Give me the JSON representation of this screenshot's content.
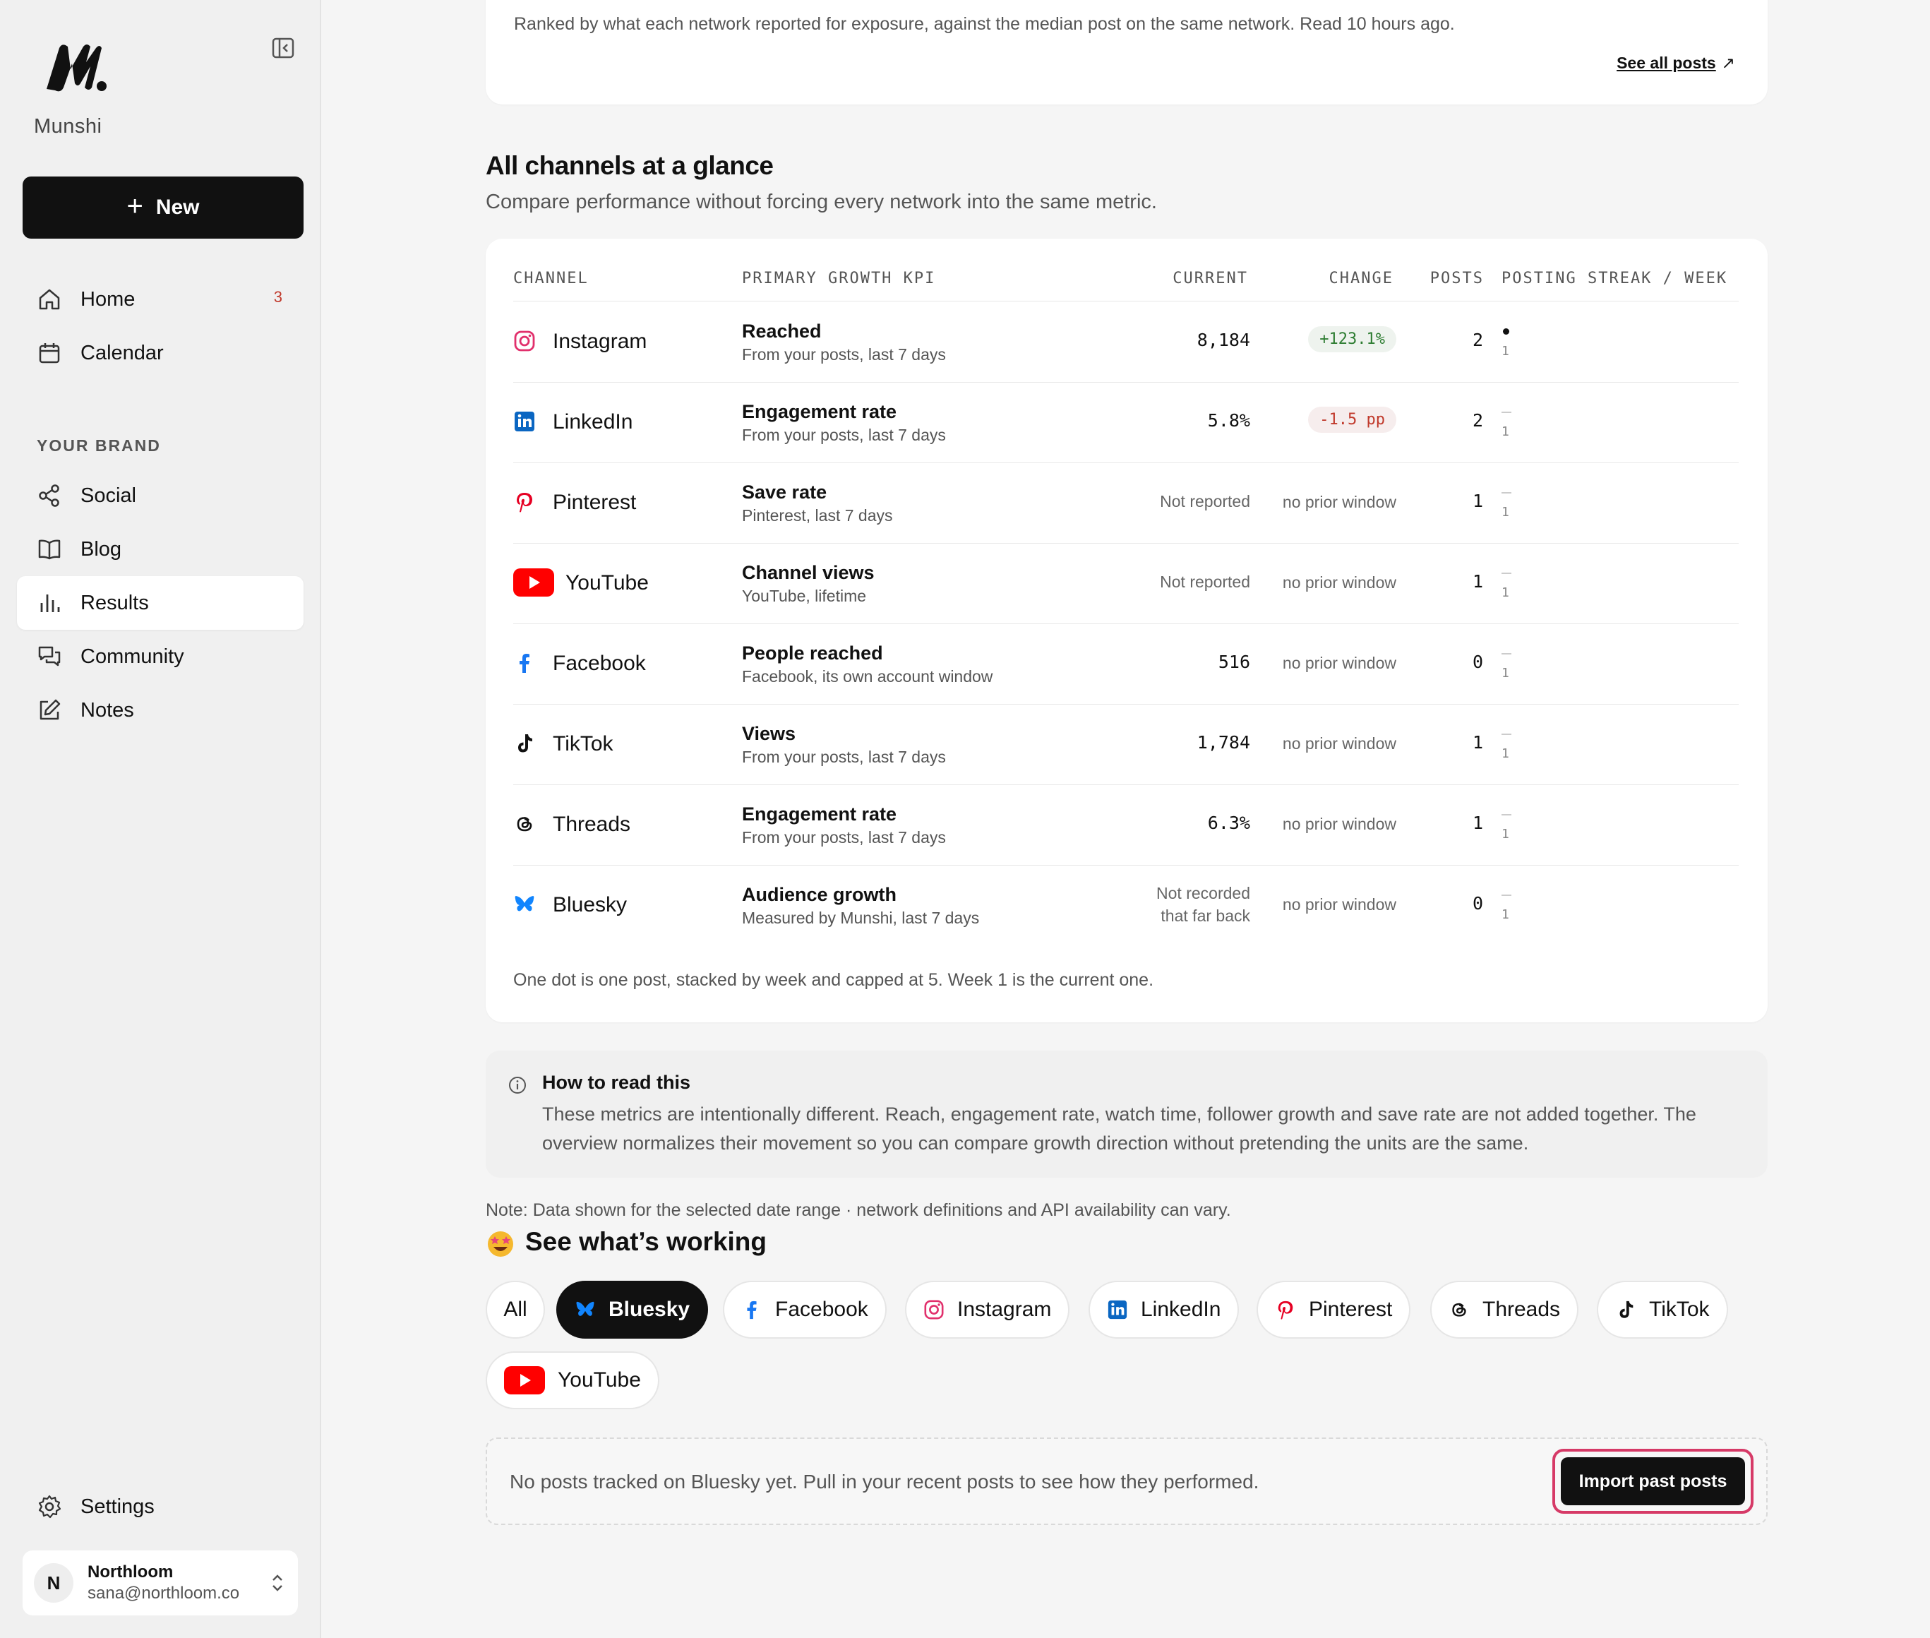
{
  "sidebar": {
    "brand": "Munshi",
    "new_label": "New",
    "nav": {
      "home": "Home",
      "home_badge": "3",
      "calendar": "Calendar",
      "section": "YOUR BRAND",
      "social": "Social",
      "blog": "Blog",
      "results": "Results",
      "community": "Community",
      "notes": "Notes",
      "settings": "Settings"
    },
    "account": {
      "initial": "N",
      "name": "Northloom",
      "email": "sana@northloom.co"
    }
  },
  "top": {
    "description": "Ranked by what each network reported for exposure, against the median post on the same network. Read 10 hours ago.",
    "see_all": "See all posts",
    "see_all_arrow": "↗"
  },
  "overview": {
    "title": "All channels at a glance",
    "subtitle": "Compare performance without forcing every network into the same metric.",
    "headers": {
      "channel": "CHANNEL",
      "kpi": "PRIMARY GROWTH KPI",
      "current": "CURRENT",
      "change": "CHANGE",
      "posts": "POSTS",
      "streak": "POSTING STREAK / WEEK"
    },
    "rows": [
      {
        "channel": "Instagram",
        "kpi": "Reached",
        "kpi_sub": "From your posts, last 7 days",
        "current": "8,184",
        "change": "+123.1%",
        "posts": "2",
        "week": "1"
      },
      {
        "channel": "LinkedIn",
        "kpi": "Engagement rate",
        "kpi_sub": "From your posts, last 7 days",
        "current": "5.8%",
        "change": "-1.5 pp",
        "posts": "2",
        "week": "1"
      },
      {
        "channel": "Pinterest",
        "kpi": "Save rate",
        "kpi_sub": "Pinterest, last 7 days",
        "current": "Not reported",
        "change": "no prior window",
        "posts": "1",
        "week": "1"
      },
      {
        "channel": "YouTube",
        "kpi": "Channel views",
        "kpi_sub": "YouTube, lifetime",
        "current": "Not reported",
        "change": "no prior window",
        "posts": "1",
        "week": "1"
      },
      {
        "channel": "Facebook",
        "kpi": "People reached",
        "kpi_sub": "Facebook, its own account window",
        "current": "516",
        "change": "no prior window",
        "posts": "0",
        "week": "1"
      },
      {
        "channel": "TikTok",
        "kpi": "Views",
        "kpi_sub": "From your posts, last 7 days",
        "current": "1,784",
        "change": "no prior window",
        "posts": "1",
        "week": "1"
      },
      {
        "channel": "Threads",
        "kpi": "Engagement rate",
        "kpi_sub": "From your posts, last 7 days",
        "current": "6.3%",
        "change": "no prior window",
        "posts": "1",
        "week": "1"
      },
      {
        "channel": "Bluesky",
        "kpi": "Audience growth",
        "kpi_sub": "Measured by Munshi, last 7 days",
        "current_line1": "Not recorded",
        "current_line2": "that far back",
        "change": "no prior window",
        "posts": "0",
        "week": "1"
      }
    ],
    "footnote": "One dot is one post, stacked by week and capped at 5. Week 1 is the current one."
  },
  "info": {
    "title": "How to read this",
    "body": "These metrics are intentionally different. Reach, engagement rate, watch time, follower growth and save rate are not added together. The overview normalizes their movement so you can compare growth direction without pretending the units are the same."
  },
  "note": "Note: Data shown for the selected date range · network definitions and API availability can vary.",
  "working": {
    "title": "See what’s working",
    "filters": [
      "All",
      "Bluesky",
      "Facebook",
      "Instagram",
      "LinkedIn",
      "Pinterest",
      "Threads",
      "TikTok",
      "YouTube"
    ],
    "active_filter": "Bluesky",
    "empty_text": "No posts tracked on Bluesky yet. Pull in your recent posts to see how they performed.",
    "import_label": "Import past posts"
  },
  "colors": {
    "instagram": "#e1306c",
    "linkedin": "#0a66c2",
    "pinterest": "#e60023",
    "youtube": "#ff0000",
    "facebook": "#1877f2",
    "bluesky": "#1185fe",
    "positive": "#2e7d32",
    "negative": "#c0392b",
    "highlight": "#d63a67"
  }
}
